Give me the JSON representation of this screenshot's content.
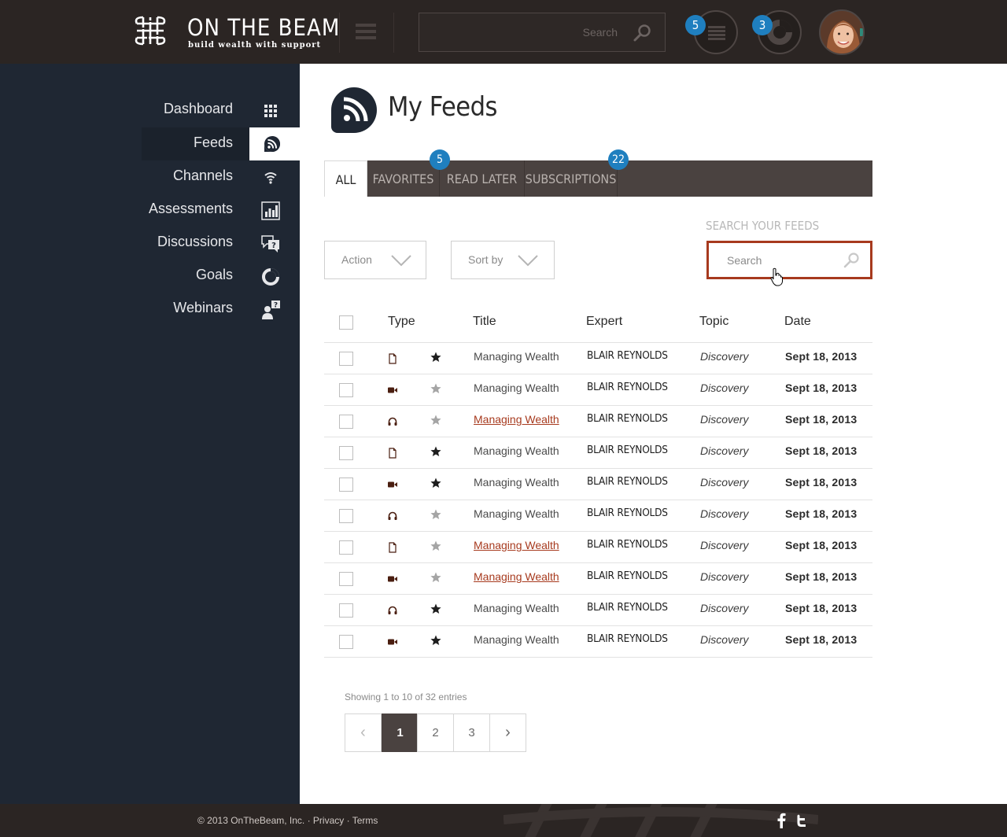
{
  "brand": {
    "title": "ON THE BEAM",
    "tagline": "build wealth with support"
  },
  "header": {
    "search_placeholder": "Search",
    "notifications_badge": "5",
    "goals_badge": "3"
  },
  "sidebar": {
    "items": [
      {
        "label": "Dashboard",
        "icon": "grid-icon"
      },
      {
        "label": "Feeds",
        "icon": "rss-icon",
        "active": true
      },
      {
        "label": "Channels",
        "icon": "wifi-icon"
      },
      {
        "label": "Assessments",
        "icon": "bar-chart-icon"
      },
      {
        "label": "Discussions",
        "icon": "chat-question-icon"
      },
      {
        "label": "Goals",
        "icon": "progress-ring-icon"
      },
      {
        "label": "Webinars",
        "icon": "presenter-icon"
      }
    ]
  },
  "main": {
    "title": "My Feeds",
    "tabs": [
      {
        "label": "ALL",
        "active": true
      },
      {
        "label": "FAVORITES",
        "badge": "5"
      },
      {
        "label": "READ LATER"
      },
      {
        "label": "SUBSCRIPTIONS",
        "badge": "22"
      }
    ],
    "action_label": "Action",
    "sortby_label": "Sort by",
    "search_label": "SEARCH YOUR FEEDS",
    "search_placeholder": "Search"
  },
  "table": {
    "columns": [
      "Type",
      "Title",
      "Expert",
      "Topic",
      "Date"
    ],
    "rows": [
      {
        "type": "document-icon",
        "starred": true,
        "title": "Managing Wealth",
        "link": false,
        "expert": "BLAIR REYNOLDS",
        "topic": "Discovery",
        "date": "Sept 18, 2013"
      },
      {
        "type": "video-icon",
        "starred": false,
        "title": "Managing Wealth",
        "link": false,
        "expert": "BLAIR REYNOLDS",
        "topic": "Discovery",
        "date": "Sept 18, 2013"
      },
      {
        "type": "audio-icon",
        "starred": false,
        "title": "Managing Wealth",
        "link": true,
        "expert": "BLAIR REYNOLDS",
        "topic": "Discovery",
        "date": "Sept 18, 2013"
      },
      {
        "type": "document-icon",
        "starred": true,
        "title": "Managing Wealth",
        "link": false,
        "expert": "BLAIR REYNOLDS",
        "topic": "Discovery",
        "date": "Sept 18, 2013"
      },
      {
        "type": "video-icon",
        "starred": true,
        "title": "Managing Wealth",
        "link": false,
        "expert": "BLAIR REYNOLDS",
        "topic": "Discovery",
        "date": "Sept 18, 2013"
      },
      {
        "type": "audio-icon",
        "starred": false,
        "title": "Managing Wealth",
        "link": false,
        "expert": "BLAIR REYNOLDS",
        "topic": "Discovery",
        "date": "Sept 18, 2013"
      },
      {
        "type": "document-icon",
        "starred": false,
        "title": "Managing Wealth",
        "link": true,
        "expert": "BLAIR REYNOLDS",
        "topic": "Discovery",
        "date": "Sept 18, 2013"
      },
      {
        "type": "video-icon",
        "starred": false,
        "title": "Managing Wealth",
        "link": true,
        "expert": "BLAIR REYNOLDS",
        "topic": "Discovery",
        "date": "Sept 18, 2013"
      },
      {
        "type": "audio-icon",
        "starred": true,
        "title": "Managing Wealth",
        "link": false,
        "expert": "BLAIR REYNOLDS",
        "topic": "Discovery",
        "date": "Sept 18, 2013"
      },
      {
        "type": "video-icon",
        "starred": true,
        "title": "Managing Wealth",
        "link": false,
        "expert": "BLAIR REYNOLDS",
        "topic": "Discovery",
        "date": "Sept 18, 2013"
      }
    ]
  },
  "pagination": {
    "showing": "Showing 1 to 10 of 32 entries",
    "prev": "‹",
    "pages": [
      "1",
      "2",
      "3"
    ],
    "current": "1",
    "next": "›"
  },
  "footer": {
    "copyright": "© 2013 OnTheBeam, Inc.",
    "sep": " · ",
    "privacy": "Privacy",
    "terms": "Terms"
  },
  "colors": {
    "topbar": "#2b2523",
    "sidebar": "#1f2733",
    "accent": "#a73a1e",
    "badge": "#1f7fbf",
    "tabbar": "#4a4240"
  }
}
